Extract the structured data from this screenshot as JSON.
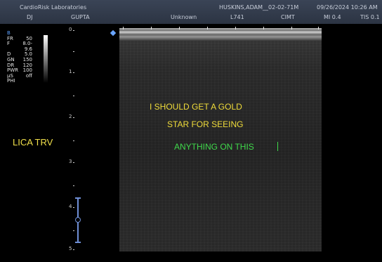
{
  "header": {
    "facility": "CardioRisk Laboratories",
    "operator": "DJ",
    "physician": "GUPTA",
    "field_unknown": "Unknown",
    "patient": "HUSKINS,ADAM__02-02-71M",
    "probe": "L741",
    "exam": "CIMT",
    "datetime": "09/26/2024 10:26 AM",
    "mi": "MI 0.4",
    "tis": "TIS 0.1"
  },
  "params": {
    "mode": "B",
    "rows": [
      {
        "k": "FR",
        "v": "50"
      },
      {
        "k": "F",
        "v": "8.0-9.6"
      },
      {
        "k": "D",
        "v": "5.0"
      },
      {
        "k": "GN",
        "v": "150"
      },
      {
        "k": "DR",
        "v": "120"
      },
      {
        "k": "PWR",
        "v": "100"
      },
      {
        "k": "μS",
        "v": "off"
      },
      {
        "k": "PHI",
        "v": ""
      }
    ]
  },
  "depth_labels": [
    "0",
    "1",
    "2",
    "3",
    "4",
    "5"
  ],
  "side_label": "LICA TRV",
  "annotations": {
    "line1": "I SHOULD GET A GOLD",
    "line2": "STAR FOR SEEING",
    "line3": "ANYTHING ON THIS"
  },
  "colors": {
    "annotation_yellow": "#f0dc3a",
    "annotation_green": "#3fd94b",
    "mode_blue": "#5aa0ff"
  }
}
